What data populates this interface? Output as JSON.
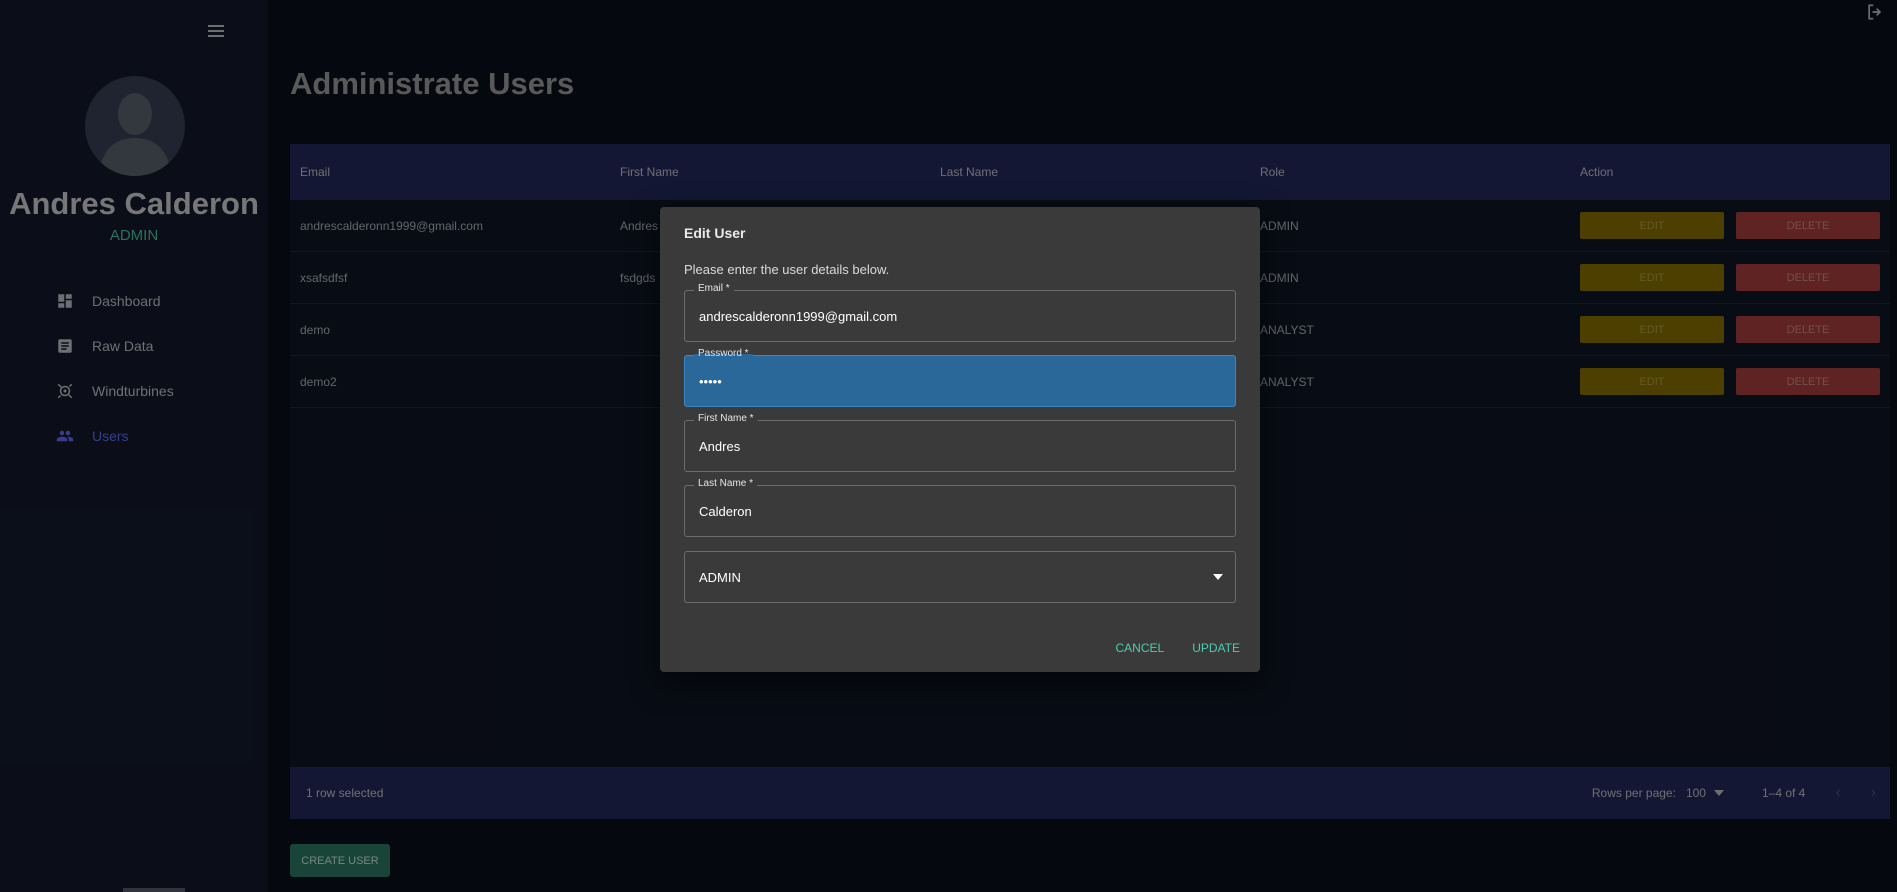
{
  "sidebar": {
    "user_name": "Andres Calderon",
    "user_role": "ADMIN",
    "items": [
      {
        "label": "Dashboard",
        "icon": "dashboard-icon"
      },
      {
        "label": "Raw Data",
        "icon": "receipt-icon"
      },
      {
        "label": "Windturbines",
        "icon": "turbine-icon"
      },
      {
        "label": "Users",
        "icon": "users-icon",
        "active": true
      }
    ]
  },
  "page": {
    "title": "Administrate Users"
  },
  "table": {
    "columns": [
      "Email",
      "First Name",
      "Last Name",
      "Role",
      "Action"
    ],
    "rows": [
      {
        "email": "andrescalderonn1999@gmail.com",
        "first_name": "Andres",
        "last_name": "",
        "role": "ADMIN"
      },
      {
        "email": "xsafsdfsf",
        "first_name": "fsdgds",
        "last_name": "",
        "role": "ADMIN"
      },
      {
        "email": "demo",
        "first_name": "",
        "last_name": "",
        "role": "ANALYST"
      },
      {
        "email": "demo2",
        "first_name": "",
        "last_name": "",
        "role": "ANALYST"
      }
    ],
    "edit_label": "EDIT",
    "delete_label": "DELETE",
    "footer": {
      "selected_text": "1 row selected",
      "rows_per_page_label": "Rows per page:",
      "rows_per_page_value": "100",
      "range_text": "1–4 of 4"
    }
  },
  "create_user_label": "CREATE USER",
  "dialog": {
    "title": "Edit User",
    "text": "Please enter the user details below.",
    "email_label": "Email *",
    "email_value": "andrescalderonn1999@gmail.com",
    "password_label": "Password *",
    "password_value": "•••••",
    "first_name_label": "First Name *",
    "first_name_value": "Andres",
    "last_name_label": "Last Name *",
    "last_name_value": "Calderon",
    "role_value": "ADMIN",
    "cancel_label": "CANCEL",
    "update_label": "UPDATE"
  },
  "colors": {
    "accent_green": "#4cceac",
    "accent_blue": "#6870fa",
    "edit_button": "#8b7400",
    "delete_button": "#b04040",
    "table_header": "#262b5e"
  }
}
